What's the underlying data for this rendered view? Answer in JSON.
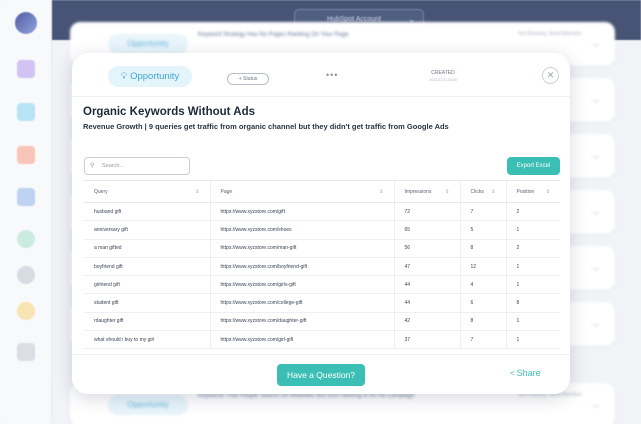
{
  "topbar": {
    "account_select": "HubSpot Account",
    "chevron_icon": "chevron-down-icon"
  },
  "background": {
    "top_card": {
      "pill": "Opportunity",
      "description": "Keyword Strategy Has No Pages Ranking On Your Page",
      "meta": "Not Ranking, Need Attention"
    },
    "bottom_card": {
      "pill": "Opportunity",
      "description": "Keywords That People Search On Websites But Don't Belong In An Ad Campaign",
      "meta": "Not Ranking, Need Attention"
    }
  },
  "modal": {
    "pill": "Opportunity",
    "status_button": "+ Status",
    "more_dots": "•••",
    "created_label": "CREATED",
    "created_date": "2022-01-01 00:00",
    "title": "Organic Keywords Without Ads",
    "subtitle": "Revenue Growth | 9 queries get traffic from organic channel but they didn't get traffic from Google Ads",
    "search_placeholder": "Search...",
    "export_label": "Export Excel",
    "table": {
      "columns": [
        "Query",
        "Page",
        "Impressions",
        "Clicks",
        "Position"
      ],
      "rows": [
        [
          "husband gift",
          "https://www.xyzstore.com/gift",
          "72",
          "7",
          "2"
        ],
        [
          "anniversary gift",
          "https://www.xyzstore.com/shoes",
          "65",
          "5",
          "1"
        ],
        [
          "a man gifted",
          "https://www.xyzstore.com/man-gift",
          "56",
          "8",
          "2"
        ],
        [
          "boyfriend gift",
          "https://www.xyzstore.com/boyfriend-gift",
          "47",
          "12",
          "1"
        ],
        [
          "girlriend gift",
          "https://www.xyzstore.com/girls-gift",
          "44",
          "4",
          "1"
        ],
        [
          "student gift",
          "https://www.xyzstore.com/college-gift",
          "44",
          "6",
          "8"
        ],
        [
          "rdaughter gift",
          "https://www.xyzstore.com/daughter-gift",
          "42",
          "8",
          "1"
        ],
        [
          "what should i buy to my girl",
          "https://www.xyzstore.com/girl-gift",
          "37",
          "7",
          "1"
        ]
      ]
    },
    "ask_button": "Have a Question?",
    "share_label": "Share"
  }
}
